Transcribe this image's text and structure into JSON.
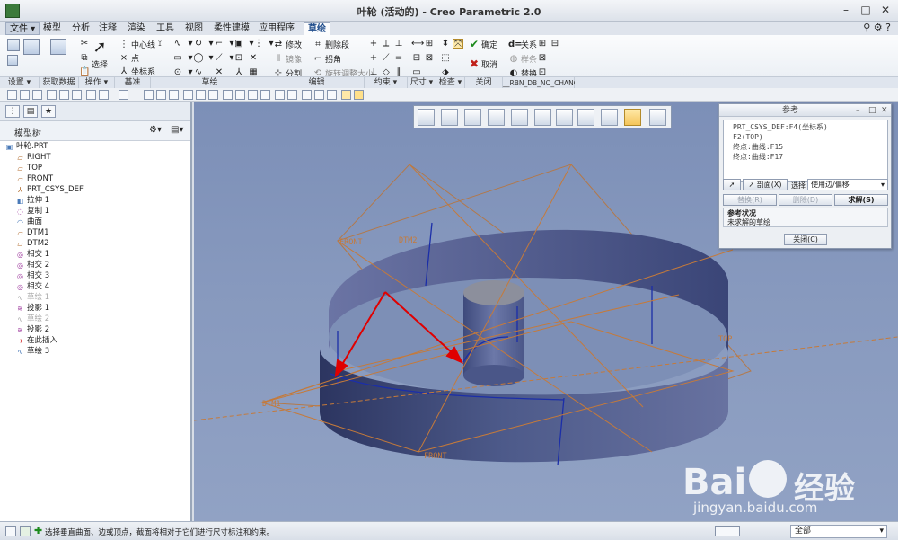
{
  "window": {
    "title": "叶轮 (活动的) - Creo Parametric 2.0",
    "minimize": "–",
    "maximize": "□",
    "close": "✕"
  },
  "ribbon": {
    "tabs": [
      {
        "label": "文件 ▾"
      },
      {
        "label": "模型"
      },
      {
        "label": "分析"
      },
      {
        "label": "注释"
      },
      {
        "label": "渲染"
      },
      {
        "label": "工具"
      },
      {
        "label": "视图"
      },
      {
        "label": "柔性建模"
      },
      {
        "label": "应用程序"
      },
      {
        "label": "草绘"
      }
    ],
    "active_tab": "草绘",
    "groups": [
      "设置 ▾",
      "获取数据",
      "操作 ▾",
      "基准",
      "草绘",
      "编辑",
      "约束 ▾",
      "尺寸 ▾",
      "检查 ▾",
      "关闭",
      "__RBN_DB_NO_CHANGE__"
    ],
    "items": {
      "select": "选择",
      "centerline": "中心线",
      "point": "点",
      "csys": "坐标系",
      "modify": "修改",
      "delete_segment": "删除段",
      "mirror": "镜像",
      "corner": "拐角",
      "divide": "分割",
      "rotate_resize": "旋转调整大小",
      "ok": "确定",
      "cancel": "取消",
      "relations": "关系",
      "sample": "样条",
      "replace": "替换"
    }
  },
  "model_tree": {
    "title": "模型树",
    "items": [
      {
        "label": "叶轮.PRT",
        "icon": "part-icon"
      },
      {
        "label": "RIGHT",
        "icon": "datum-plane-icon"
      },
      {
        "label": "TOP",
        "icon": "datum-plane-icon"
      },
      {
        "label": "FRONT",
        "icon": "datum-plane-icon"
      },
      {
        "label": "PRT_CSYS_DEF",
        "icon": "csys-icon"
      },
      {
        "label": "拉伸 1",
        "icon": "extrude-icon"
      },
      {
        "label": "复制 1",
        "icon": "copy-icon"
      },
      {
        "label": "曲面",
        "icon": "surface-icon"
      },
      {
        "label": "DTM1",
        "icon": "datum-plane-icon"
      },
      {
        "label": "DTM2",
        "icon": "datum-plane-icon"
      },
      {
        "label": "相交 1",
        "icon": "intersect-icon"
      },
      {
        "label": "相交 2",
        "icon": "intersect-icon"
      },
      {
        "label": "相交 3",
        "icon": "intersect-icon"
      },
      {
        "label": "相交 4",
        "icon": "intersect-icon"
      },
      {
        "label": "草绘 1",
        "icon": "sketch-icon",
        "dim": true
      },
      {
        "label": "投影 1",
        "icon": "project-icon"
      },
      {
        "label": "草绘 2",
        "icon": "sketch-icon",
        "dim": true
      },
      {
        "label": "投影 2",
        "icon": "project-icon"
      },
      {
        "label": "在此插入",
        "icon": "insert-here-icon"
      },
      {
        "label": "草绘 3",
        "icon": "sketch-icon"
      }
    ]
  },
  "viewport": {
    "labels": {
      "front_top": "FRONT",
      "dtm2": "DTM2",
      "top": "TOP",
      "dtm1": "DTM1",
      "front_bottom": "FRONT"
    }
  },
  "reference_dialog": {
    "title": "参考",
    "references": [
      "PRT_CSYS_DEF:F4(坐标系)",
      "F2(TOP)",
      "终点:曲线:F15",
      "终点:曲线:F17"
    ],
    "section_button": "剖面(X)",
    "select_label": "选择",
    "select_value": "使用边/偏移",
    "replace_button": "替换(R)",
    "delete_button": "删除(D)",
    "solve_button": "求解(S)",
    "status_title": "参考状况",
    "status_text": "未求解的草绘",
    "close_button": "关闭(C)"
  },
  "statusbar": {
    "message": "选择垂直曲面、边或顶点，截面将相对于它们进行尺寸标注和约束。",
    "filter": "全部"
  },
  "watermark": {
    "brand": "Bai",
    "brand_cn": "经验",
    "url": "jingyan.baidu.com"
  }
}
